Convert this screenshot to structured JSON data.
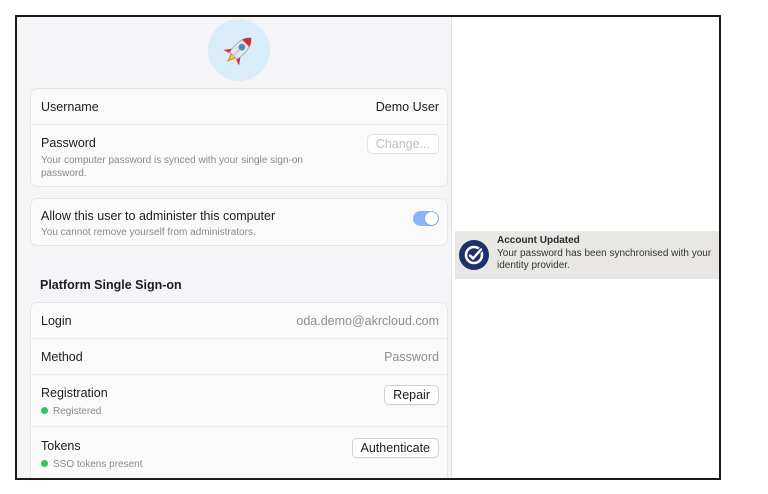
{
  "avatar": {
    "icon": "rocket-icon"
  },
  "account": {
    "username_label": "Username",
    "username_value": "Demo User",
    "password_label": "Password",
    "password_description": "Your computer password is synced with your single sign-on password.",
    "change_button": "Change..."
  },
  "admin": {
    "label": "Allow this user to administer this computer",
    "description": "You cannot remove yourself from administrators.",
    "toggle_state": "on"
  },
  "sso": {
    "heading": "Platform Single Sign-on",
    "login_label": "Login",
    "login_value": "oda.demo@akrcloud.com",
    "method_label": "Method",
    "method_value": "Password",
    "registration_label": "Registration",
    "registration_status": "Registered",
    "repair_button": "Repair",
    "tokens_label": "Tokens",
    "tokens_status": "SSO tokens present",
    "authenticate_button": "Authenticate"
  },
  "notification": {
    "title": "Account Updated",
    "body": "Your password has been synchronised with your identity provider.",
    "icon": "check-shield-icon"
  },
  "colors": {
    "accent": "#8ab4f2",
    "status_green": "#33c759",
    "notification_icon_bg": "#1e2f6e"
  }
}
